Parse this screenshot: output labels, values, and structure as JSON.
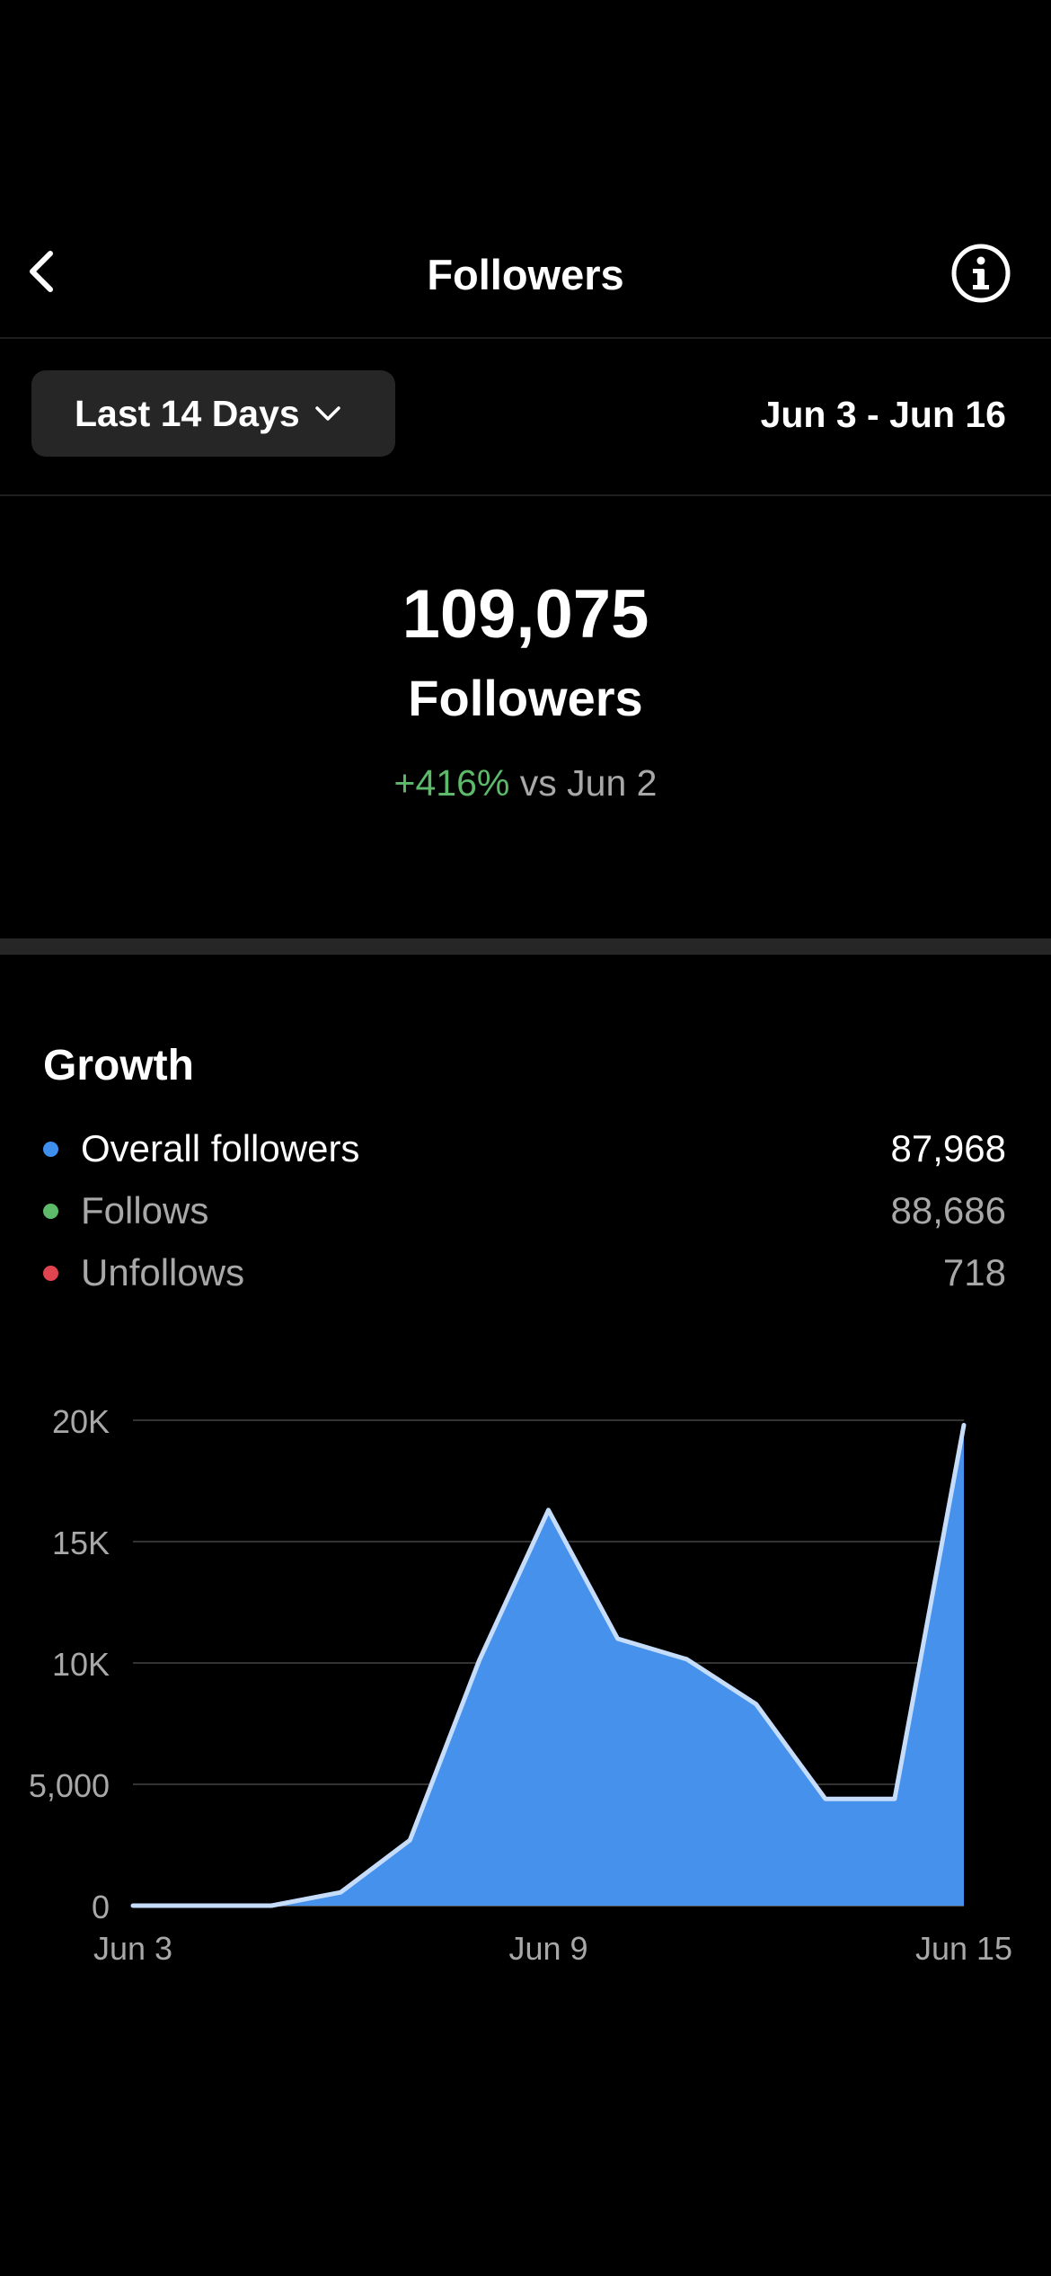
{
  "nav": {
    "title": "Followers"
  },
  "filter": {
    "range_label": "Last 14 Days",
    "date_range": "Jun 3 - Jun 16"
  },
  "summary": {
    "total": "109,075",
    "label": "Followers",
    "change": "+416%",
    "change_suffix": " vs Jun 2"
  },
  "growth": {
    "title": "Growth",
    "legend": [
      {
        "label": "Overall followers",
        "value": "87,968",
        "color": "#3f8fef"
      },
      {
        "label": "Follows",
        "value": "88,686",
        "color": "#5cba6a"
      },
      {
        "label": "Unfollows",
        "value": "718",
        "color": "#e0444e"
      }
    ]
  },
  "colors": {
    "accent": "#4591ec",
    "positive": "#5cba6a",
    "line": "#c6dcfb"
  },
  "chart_data": {
    "type": "area",
    "x": [
      "Jun 3",
      "Jun 4",
      "Jun 5",
      "Jun 6",
      "Jun 7",
      "Jun 8",
      "Jun 9",
      "Jun 10",
      "Jun 11",
      "Jun 12",
      "Jun 13",
      "Jun 14",
      "Jun 15"
    ],
    "series": [
      {
        "values": [
          0,
          0,
          0,
          550,
          2700,
          10100,
          16300,
          11000,
          10150,
          8300,
          4400,
          4400,
          19800
        ]
      }
    ],
    "x_tick_labels": [
      "Jun 3",
      "Jun 9",
      "Jun 15"
    ],
    "y_ticks": [
      0,
      5000,
      10000,
      15000,
      20000
    ],
    "y_tick_labels": [
      "0",
      "5,000",
      "10K",
      "15K",
      "20K"
    ],
    "ylim": [
      0,
      20000
    ],
    "grid": true
  }
}
